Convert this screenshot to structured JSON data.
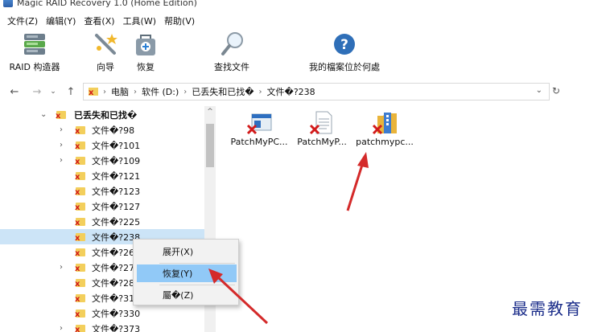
{
  "window": {
    "title": "Magic RAID Recovery 1.0 (Home Edition)"
  },
  "menu": [
    {
      "label": "文件(Z)"
    },
    {
      "label": "编辑(Y)"
    },
    {
      "label": "查看(X)"
    },
    {
      "label": "工具(W)"
    },
    {
      "label": "帮助(V)"
    }
  ],
  "toolbar": {
    "raid_builder": "RAID 构造器",
    "wizard": "向导",
    "recover": "恢复",
    "find_files": "查找文件",
    "where_is_my_file": "我的檔案位於何處"
  },
  "address": {
    "crumbs": [
      "电脑",
      "软件 (D:)",
      "已丢失和已找�",
      "文件�?238"
    ]
  },
  "tree": {
    "root": "已丢失和已找�",
    "items": [
      {
        "label": "文件�?98"
      },
      {
        "label": "文件�?101"
      },
      {
        "label": "文件�?109"
      },
      {
        "label": "文件�?121"
      },
      {
        "label": "文件�?123"
      },
      {
        "label": "文件�?127"
      },
      {
        "label": "文件�?225"
      },
      {
        "label": "文件�?238"
      },
      {
        "label": "文件�?26"
      },
      {
        "label": "文件�?27"
      },
      {
        "label": "文件�?28"
      },
      {
        "label": "文件�?31"
      },
      {
        "label": "文件�?330"
      },
      {
        "label": "文件�?373"
      }
    ]
  },
  "files": [
    {
      "name": "PatchMyPC...",
      "icon": "window-file-icon"
    },
    {
      "name": "PatchMyP...",
      "icon": "document-file-icon"
    },
    {
      "name": "patchmypc...",
      "icon": "archive-file-icon"
    }
  ],
  "context_menu": {
    "expand": "展开(X)",
    "recover": "恢复(Y)",
    "properties": "屬�(Z)"
  },
  "watermark": "最需教育",
  "colors": {
    "selection": "#cce4f7",
    "menu_highlight": "#91c9f7",
    "folder": "#f3cf5c",
    "deleted_mark": "#d21a1a",
    "arrow": "#d42a2a",
    "watermark": "#1b2d8a"
  }
}
